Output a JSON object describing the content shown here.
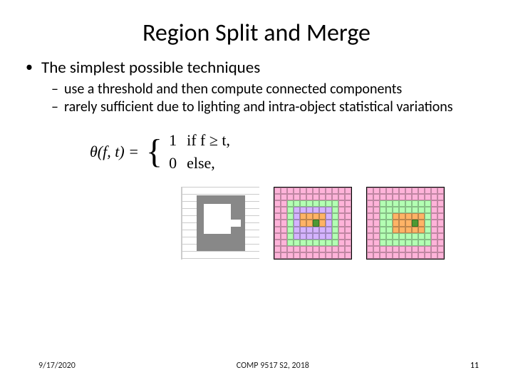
{
  "title": "Region Split and Merge",
  "bullet1": "The simplest possible techniques",
  "sub1": "use a threshold and then compute connected components",
  "sub2": "rarely sufficient due to lighting and intra-object statistical variations",
  "formula": {
    "lhs": "θ(f, t) =",
    "case1_val": "1",
    "case1_cond": "if f ≥ t,",
    "case2_val": "0",
    "case2_cond": "else,"
  },
  "footer": {
    "date": "9/17/2020",
    "course": "COMP 9517 S2, 2018",
    "page": "11"
  }
}
